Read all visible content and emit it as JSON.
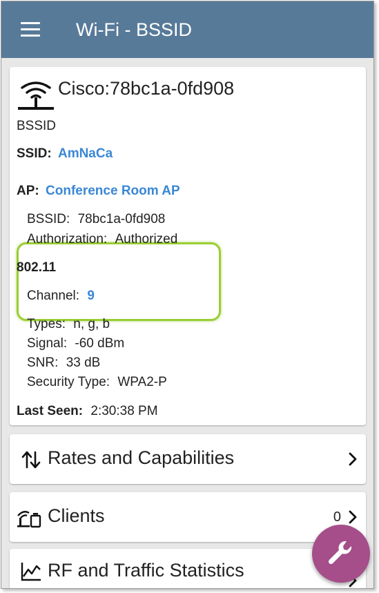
{
  "appbar": {
    "title": "Wi-Fi - BSSID",
    "color": "#587a99"
  },
  "device": {
    "name": "Cisco:78bc1a-0fd908",
    "type": "BSSID",
    "ssid_label": "SSID:",
    "ssid_value": "AmNaCa",
    "ap_label": "AP:",
    "ap_value": "Conference Room AP",
    "ap_bssid_label": "BSSID:",
    "ap_bssid_value": "78bc1a-0fd908",
    "authorization_label": "Authorization:",
    "authorization_value": "Authorized",
    "section_80211": "802.11",
    "channel_label": "Channel:",
    "channel_value": "9",
    "types_label": "Types:",
    "types_value": "n, g, b",
    "signal_label": "Signal:",
    "signal_value": "-60 dBm",
    "snr_label": "SNR:",
    "snr_value": "33 dB",
    "security_label": "Security Type:",
    "security_value": "WPA2-P",
    "last_seen_label": "Last Seen:",
    "last_seen_value": "2:30:38 PM"
  },
  "rows": {
    "rates": {
      "label": "Rates and Capabilities",
      "icon": "sort-arrows-icon"
    },
    "clients": {
      "label": "Clients",
      "count": "0",
      "icon": "clients-icon"
    },
    "rf": {
      "label": "RF and Traffic Statistics",
      "icon": "line-chart-icon"
    }
  },
  "fab": {
    "icon": "wrench-icon",
    "color": "#a54e8a"
  },
  "colors": {
    "link": "#3a87d6",
    "highlight": "#9acd32"
  }
}
